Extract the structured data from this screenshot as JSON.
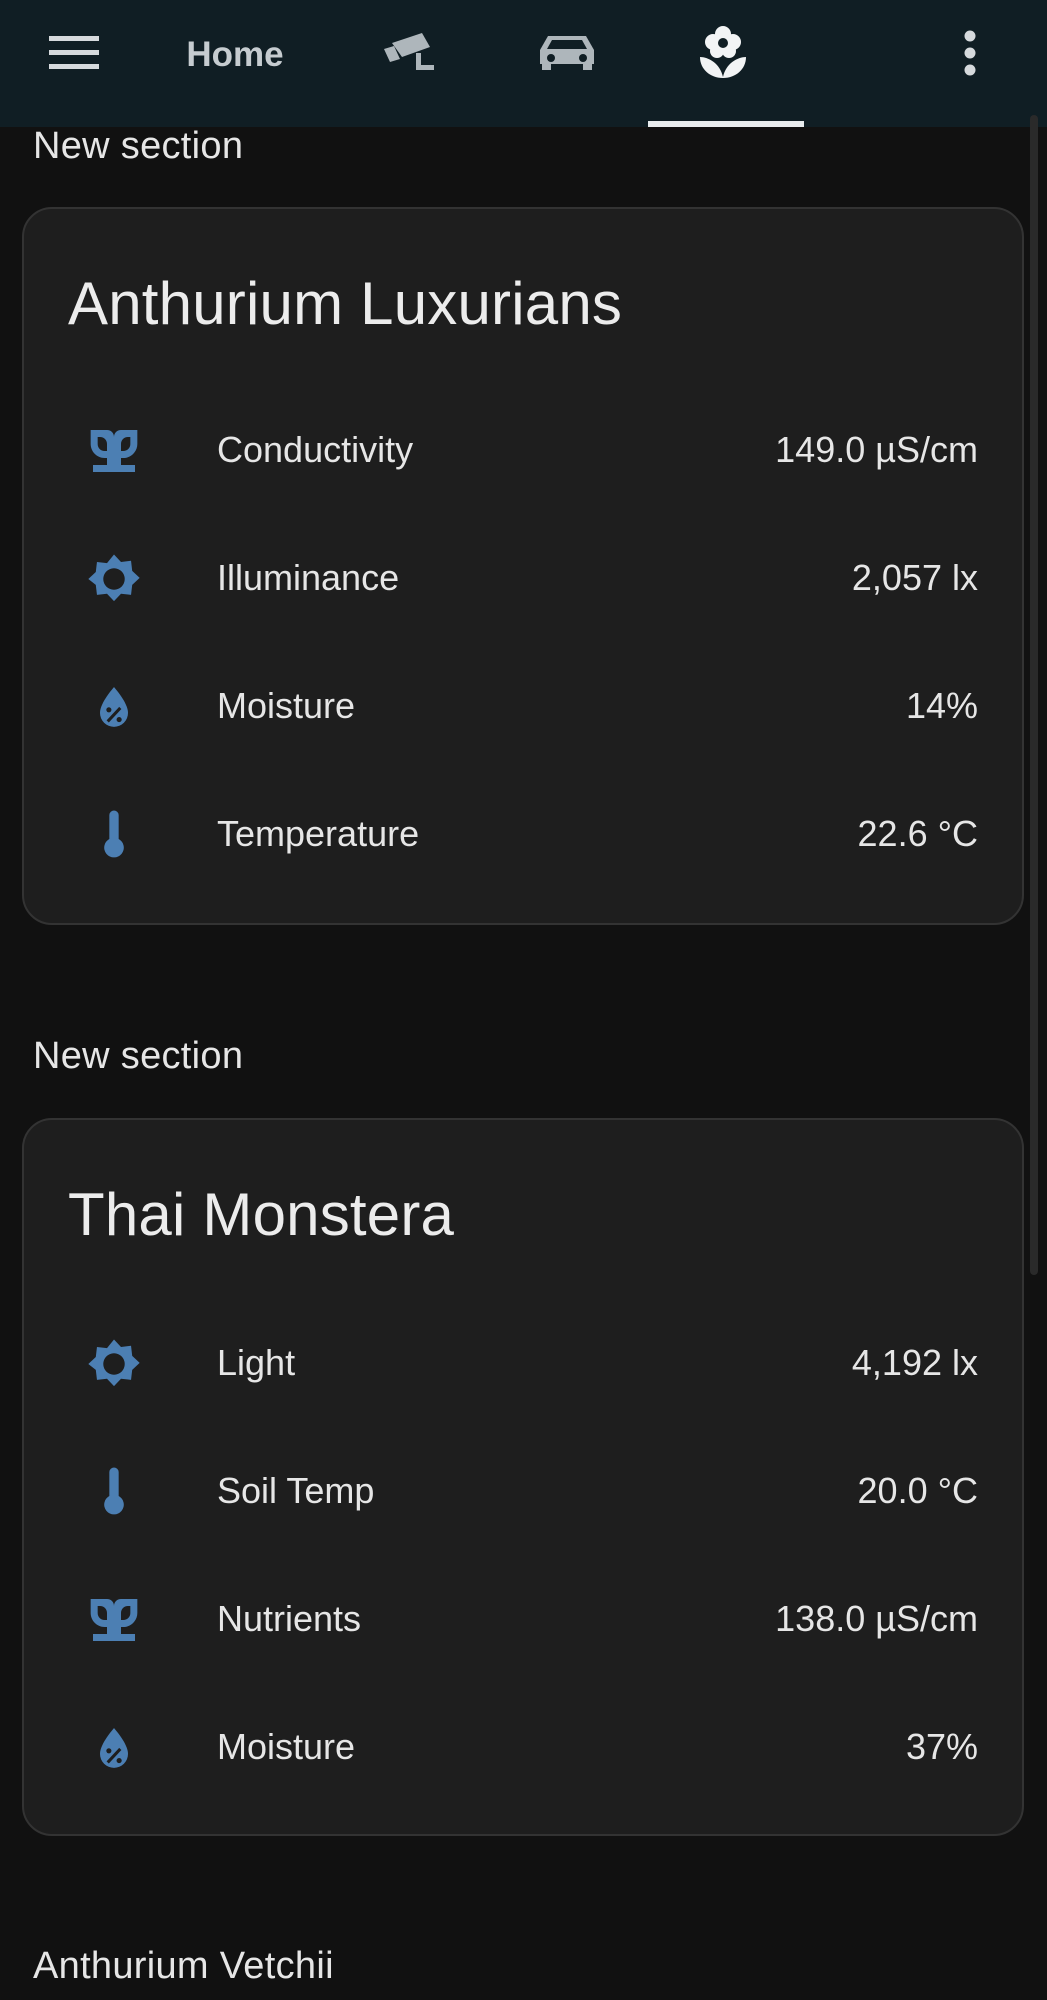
{
  "header": {
    "home_label": "Home",
    "tabs": [
      {
        "icon": "home-label",
        "label": "Home"
      },
      {
        "icon": "cctv-icon"
      },
      {
        "icon": "car-icon"
      },
      {
        "icon": "flower-icon",
        "active": true
      }
    ]
  },
  "colors": {
    "accent": "#4c7fb3",
    "card_background": "#1e1e1e",
    "page_background": "#111111",
    "header_background": "#101e24"
  },
  "sections": [
    {
      "heading": "New section",
      "card": {
        "title": "Anthurium Luxurians",
        "rows": [
          {
            "icon": "sprout-icon",
            "name": "Conductivity",
            "value": "149.0 µS/cm"
          },
          {
            "icon": "sun-icon",
            "name": "Illuminance",
            "value": "2,057 lx"
          },
          {
            "icon": "water-percent-icon",
            "name": "Moisture",
            "value": "14%"
          },
          {
            "icon": "thermometer-icon",
            "name": "Temperature",
            "value": "22.6 °C"
          }
        ]
      }
    },
    {
      "heading": "New section",
      "card": {
        "title": "Thai Monstera",
        "rows": [
          {
            "icon": "sun-icon",
            "name": "Light",
            "value": "4,192 lx"
          },
          {
            "icon": "thermometer-icon",
            "name": "Soil Temp",
            "value": "20.0 °C"
          },
          {
            "icon": "sprout-icon",
            "name": "Nutrients",
            "value": "138.0 µS/cm"
          },
          {
            "icon": "water-percent-icon",
            "name": "Moisture",
            "value": "37%"
          }
        ]
      }
    },
    {
      "heading": "Anthurium Vetchii"
    }
  ]
}
